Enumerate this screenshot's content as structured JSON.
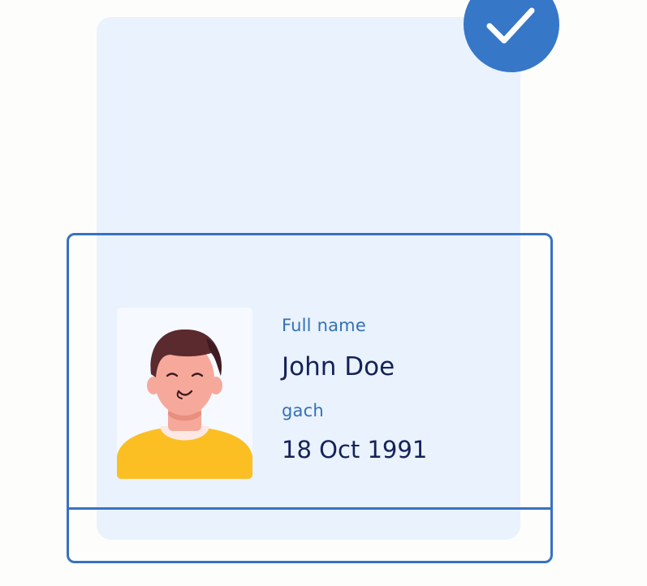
{
  "card": {
    "full_name_label": "Full name",
    "full_name_value": "John Doe",
    "date_label": "gach",
    "date_value": "18 Oct 1991"
  },
  "icons": {
    "badge": "check-icon",
    "photo": "person-avatar"
  },
  "colors": {
    "accent": "#3677c8",
    "card_background": "#e9f2fd",
    "label_text": "#3470b8",
    "value_text": "#142258",
    "shirt": "#fbbf24",
    "hair": "#5a2a2e",
    "skin": "#f6a99a"
  }
}
